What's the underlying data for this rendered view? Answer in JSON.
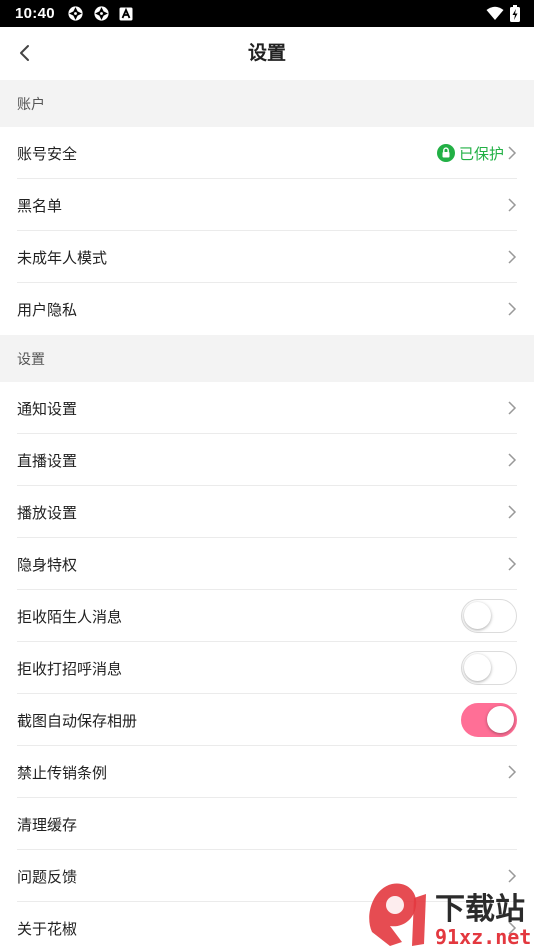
{
  "status_bar": {
    "time": "10:40",
    "icons": [
      "settings-gear-icon",
      "settings-gear-icon",
      "notification-a-icon",
      "wifi-icon",
      "battery-charging-icon"
    ]
  },
  "header": {
    "title": "设置",
    "back_icon": "chevron-left-icon"
  },
  "sections": [
    {
      "title": "账户",
      "items": [
        {
          "label": "账号安全",
          "badge": "已保护",
          "type": "link"
        },
        {
          "label": "黑名单",
          "type": "link"
        },
        {
          "label": "未成年人模式",
          "type": "link"
        },
        {
          "label": "用户隐私",
          "type": "link"
        }
      ]
    },
    {
      "title": "设置",
      "items": [
        {
          "label": "通知设置",
          "type": "link"
        },
        {
          "label": "直播设置",
          "type": "link"
        },
        {
          "label": "播放设置",
          "type": "link"
        },
        {
          "label": "隐身特权",
          "type": "link"
        },
        {
          "label": "拒收陌生人消息",
          "type": "toggle",
          "on": false
        },
        {
          "label": "拒收打招呼消息",
          "type": "toggle",
          "on": false
        },
        {
          "label": "截图自动保存相册",
          "type": "toggle",
          "on": true
        },
        {
          "label": "禁止传销条例",
          "type": "link"
        },
        {
          "label": "清理缓存",
          "type": "plain"
        },
        {
          "label": "问题反馈",
          "type": "link"
        },
        {
          "label": "关于花椒",
          "type": "link"
        }
      ]
    }
  ],
  "colors": {
    "accent_pink": "#ff6f96",
    "protected_green": "#22b045",
    "section_bg": "#f3f3f3"
  },
  "watermark": {
    "logo_text": "下载站",
    "url_text": "91xz.net"
  }
}
